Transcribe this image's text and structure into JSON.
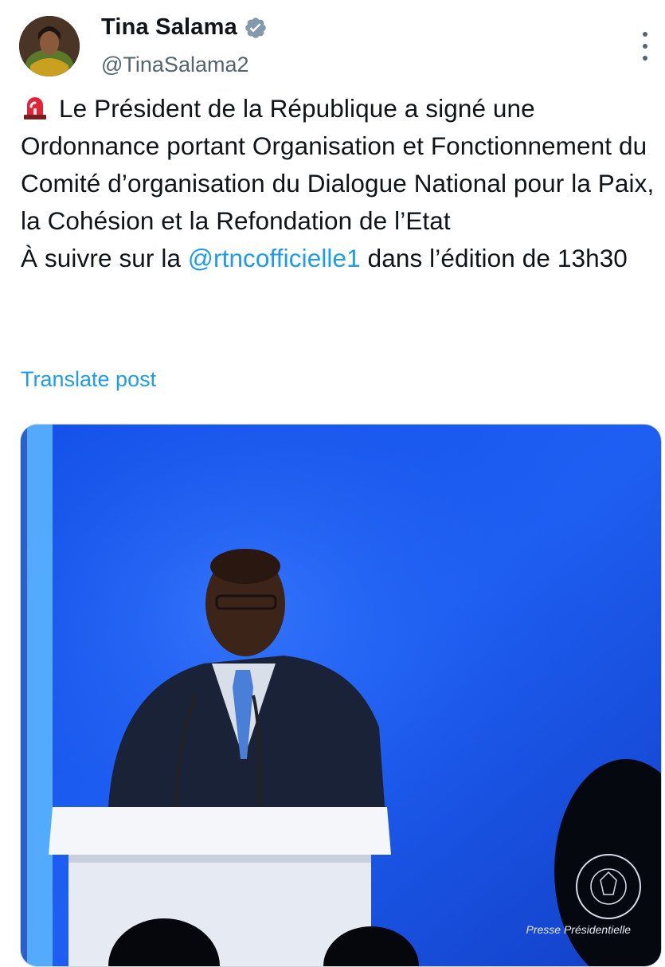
{
  "post": {
    "author": {
      "display_name": "Tina Salama",
      "handle": "@TinaSalama2",
      "verified": true
    },
    "text": {
      "emoji": "rotating-light-icon",
      "body": "Le Président de la République a signé une Ordonnance portant Organisation et Fonctionnement du Comité d’organisation du Dialogue National pour la Paix, la Cohésion et la Refondation de l’Etat",
      "line2_before": "À suivre sur la ",
      "mention": "@rtncofficielle1",
      "line2_after": " dans l’édition de 13h30"
    },
    "translate_label": "Translate post",
    "media": {
      "type": "photo",
      "watermark": "Presse Présidentielle"
    }
  },
  "colors": {
    "link": "#1d9bf0",
    "secondary_text": "#536471",
    "photo_background": "#1d4ff0"
  }
}
